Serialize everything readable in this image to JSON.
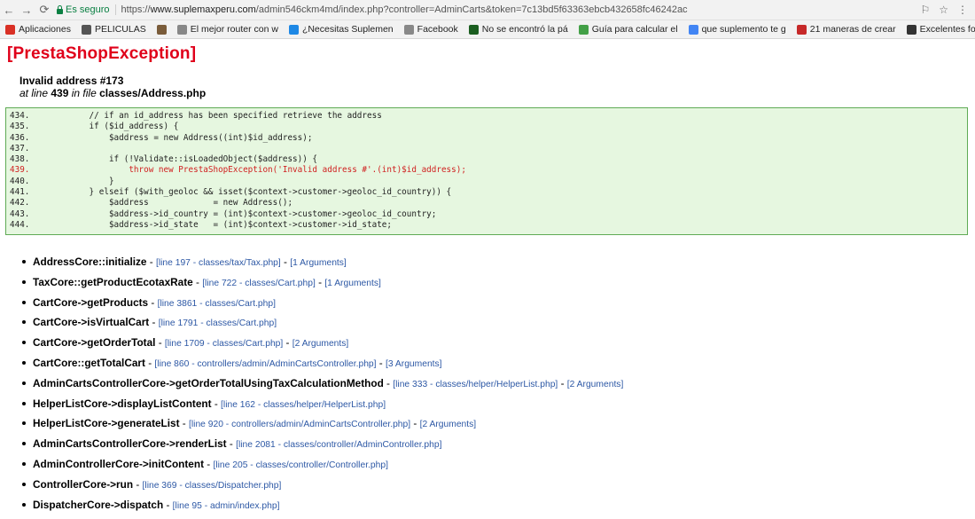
{
  "browser": {
    "secure_label": "Es seguro",
    "url_prefix": "https://",
    "url_host": "www.suplemaxperu.com",
    "url_path": "/admin546ckm4md/index.php?controller=AdminCarts&token=7c13bd5f63363ebcb432658fc46242ac",
    "bookmarks": [
      {
        "label": "Aplicaciones",
        "icon": "apps-grid-icon",
        "color": "#d93025"
      },
      {
        "label": "PELICULAS",
        "icon": "film-icon",
        "color": "#555555"
      },
      {
        "label": "",
        "icon": "figure-icon",
        "color": "#7a5c3a"
      },
      {
        "label": "El mejor router con w",
        "icon": "page-icon",
        "color": "#888888"
      },
      {
        "label": "¿Necesitas Suplemen",
        "icon": "cloud-icon",
        "color": "#1e88e5"
      },
      {
        "label": "Facebook",
        "icon": "page-icon",
        "color": "#888888"
      },
      {
        "label": "No se encontró la pá",
        "icon": "plane-icon",
        "color": "#1b5e20"
      },
      {
        "label": "Guía para calcular el",
        "icon": "bag-icon",
        "color": "#43a047"
      },
      {
        "label": "que suplemento te g",
        "icon": "google-icon",
        "color": "#4285f4"
      },
      {
        "label": "21 maneras de crear",
        "icon": "md-icon",
        "color": "#c62828"
      },
      {
        "label": "Excelentes fondos pa",
        "icon": "ff-icon",
        "color": "#333333"
      }
    ],
    "more": "»"
  },
  "error": {
    "title": "[PrestaShopException]",
    "message": "Invalid address #173",
    "at_line_prefix": "at line",
    "line": "439",
    "in_file": "in file",
    "file": "classes/Address.php"
  },
  "code_lines": [
    {
      "text": "434.            // if an id_address has been specified retrieve the address",
      "error": false
    },
    {
      "text": "435.            if ($id_address) {",
      "error": false
    },
    {
      "text": "436.                $address = new Address((int)$id_address);",
      "error": false
    },
    {
      "text": "437.",
      "error": false
    },
    {
      "text": "438.                if (!Validate::isLoadedObject($address)) {",
      "error": false
    },
    {
      "text": "439.                    throw new PrestaShopException('Invalid address #'.(int)$id_address);",
      "error": true
    },
    {
      "text": "440.                }",
      "error": false
    },
    {
      "text": "441.            } elseif ($with_geoloc && isset($context->customer->geoloc_id_country)) {",
      "error": false
    },
    {
      "text": "442.                $address             = new Address();",
      "error": false
    },
    {
      "text": "443.                $address->id_country = (int)$context->customer->geoloc_id_country;",
      "error": false
    },
    {
      "text": "444.                $address->id_state   = (int)$context->customer->id_state;",
      "error": false
    }
  ],
  "trace": [
    {
      "fn": "AddressCore::initialize",
      "link": "[line 197 - classes/tax/Tax.php]",
      "args": "[1 Arguments]"
    },
    {
      "fn": "TaxCore::getProductEcotaxRate",
      "link": "[line 722 - classes/Cart.php]",
      "args": "[1 Arguments]"
    },
    {
      "fn": "CartCore->getProducts",
      "link": "[line 3861 - classes/Cart.php]",
      "args": ""
    },
    {
      "fn": "CartCore->isVirtualCart",
      "link": "[line 1791 - classes/Cart.php]",
      "args": ""
    },
    {
      "fn": "CartCore->getOrderTotal",
      "link": "[line 1709 - classes/Cart.php]",
      "args": "[2 Arguments]"
    },
    {
      "fn": "CartCore::getTotalCart",
      "link": "[line 860 - controllers/admin/AdminCartsController.php]",
      "args": "[3 Arguments]"
    },
    {
      "fn": "AdminCartsControllerCore->getOrderTotalUsingTaxCalculationMethod",
      "link": "[line 333 - classes/helper/HelperList.php]",
      "args": "[2 Arguments]"
    },
    {
      "fn": "HelperListCore->displayListContent",
      "link": "[line 162 - classes/helper/HelperList.php]",
      "args": ""
    },
    {
      "fn": "HelperListCore->generateList",
      "link": "[line 920 - controllers/admin/AdminCartsController.php]",
      "args": "[2 Arguments]"
    },
    {
      "fn": "AdminCartsControllerCore->renderList",
      "link": "[line 2081 - classes/controller/AdminController.php]",
      "args": ""
    },
    {
      "fn": "AdminControllerCore->initContent",
      "link": "[line 205 - classes/controller/Controller.php]",
      "args": ""
    },
    {
      "fn": "ControllerCore->run",
      "link": "[line 369 - classes/Dispatcher.php]",
      "args": ""
    },
    {
      "fn": "DispatcherCore->dispatch",
      "link": "[line 95 - admin/index.php]",
      "args": ""
    }
  ]
}
